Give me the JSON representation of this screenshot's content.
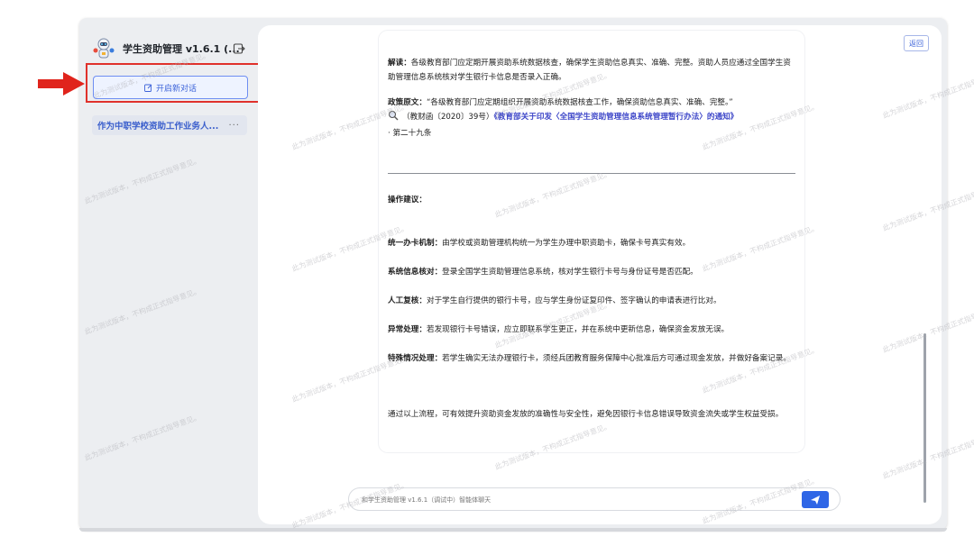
{
  "app": {
    "title": "学生资助管理 v1.6.1 (...",
    "new_chat_label": "开启新对话",
    "conversation_title": "作为中职学校资助工作业务人...",
    "more_label": "···"
  },
  "main": {
    "back_label": "返回",
    "message": {
      "interpret_label": "解读：",
      "interpret_text": "各级教育部门应定期开展资助系统数据核查，确保学生资助信息真实、准确、完整。资助人员应通过全国学生资助管理信息系统核对学生银行卡信息是否录入正确。",
      "policy_label": "政策原文：",
      "policy_text": "“各级教育部门应定期组织开展资助系统数据核查工作，确保资助信息真实、准确、完整。”",
      "doc_ref": "（教财函〔2020〕39号）",
      "doc_link": "《教育部关于印发〈全国学生资助管理信息系统管理暂行办法〉的通知》",
      "doc_article": "· 第二十九条",
      "suggest_heading": "操作建议：",
      "items": [
        {
          "label": "统一办卡机制：",
          "text": "由学校或资助管理机构统一为学生办理中职资助卡，确保卡号真实有效。"
        },
        {
          "label": "系统信息核对：",
          "text": "登录全国学生资助管理信息系统，核对学生银行卡号与身份证号是否匹配。"
        },
        {
          "label": "人工复核：",
          "text": "对于学生自行提供的银行卡号，应与学生身份证复印件、签字确认的申请表进行比对。"
        },
        {
          "label": "异常处理：",
          "text": "若发现银行卡号错误，应立即联系学生更正，并在系统中更新信息，确保资金发放无误。"
        },
        {
          "label": "特殊情况处理：",
          "text": "若学生确实无法办理银行卡，须经兵团教育服务保障中心批准后方可通过现金发放，并做好备案记录。"
        }
      ],
      "conclusion": "通过以上流程，可有效提升资助资金发放的准确性与安全性，避免因银行卡信息错误导致资金流失或学生权益受损。"
    },
    "input_placeholder": "和学生资助管理 v1.6.1（调试中）智能体聊天"
  },
  "watermark_text": "此为测试版本，不构成正式指导意见。",
  "colors": {
    "accent": "#2f66e6",
    "highlight": "#e0312b",
    "link": "#3c45c8"
  }
}
